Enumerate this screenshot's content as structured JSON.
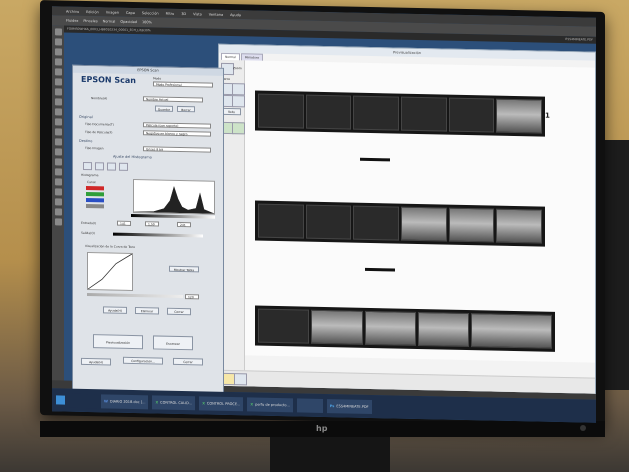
{
  "photoshop": {
    "menu": [
      "Archivo",
      "Edición",
      "Imagen",
      "Capa",
      "Selección",
      "Filtro",
      "3D",
      "Vista",
      "Ventana",
      "Ayuda"
    ],
    "options": [
      "Fluidez",
      "Pinceles",
      "Normal",
      "Opacidad",
      "100%"
    ],
    "tab_title": "FO8MS0WHXA_0003_HB8010234_00001_ECH_Lit@30%",
    "right_tab": "ESS4MINEATE.PDF"
  },
  "preview": {
    "title": "Previsualización",
    "tabs": [
      "Normal",
      "Miniatura"
    ],
    "side_buttons": [
      "Zoom",
      "Marco",
      "Todo"
    ],
    "film_markers": [
      "1"
    ]
  },
  "epson": {
    "window_title": "EPSON Scan",
    "brand": "EPSON Scan",
    "mode_label": "Modo",
    "mode_value": "Modo Profesional",
    "config_label": "Nombre(A)",
    "config_value": "Nombre Actual",
    "save_label": "Guardar",
    "delete_label": "Borrar",
    "original_label": "Original",
    "doc_type_label": "Tipo Documento(T)",
    "doc_type_value": "Película (con soporte)",
    "film_type_label": "Tipo de Película(F)",
    "film_type_value": "Negativo en blanco y negro",
    "dest_label": "Destino",
    "image_type_label": "Tipo Imagen",
    "image_type_value": "Grises 8 bit",
    "histogram_title": "Ajuste del Histograma",
    "histogram_sub": "Histograma",
    "channel_label": "Canal",
    "input_label": "Entrada(I)",
    "input_values": [
      "141",
      "1,50",
      "241"
    ],
    "output_label": "Salida(O)",
    "curve_label": "Visualización de la Curva de Tono",
    "show_table": "Mostrar Tabla",
    "output_value": "120",
    "buttons": [
      "Ayuda(H)",
      "Eliminar",
      "Cerrar"
    ],
    "preview_btn": "Previsualización",
    "scan_btn": "Escanear",
    "help_btn": "Ayuda(H)",
    "config_btn": "Configuración...",
    "close_btn": "Cerrar"
  },
  "taskbar": {
    "items": [
      "DIARIO 2018.doc [...",
      "CONTROL CALID...",
      "CONTROL PROCE...",
      "perfo de producto...",
      "ESS4MINEATE.PDF"
    ]
  },
  "monitor": {
    "brand": "hp"
  }
}
